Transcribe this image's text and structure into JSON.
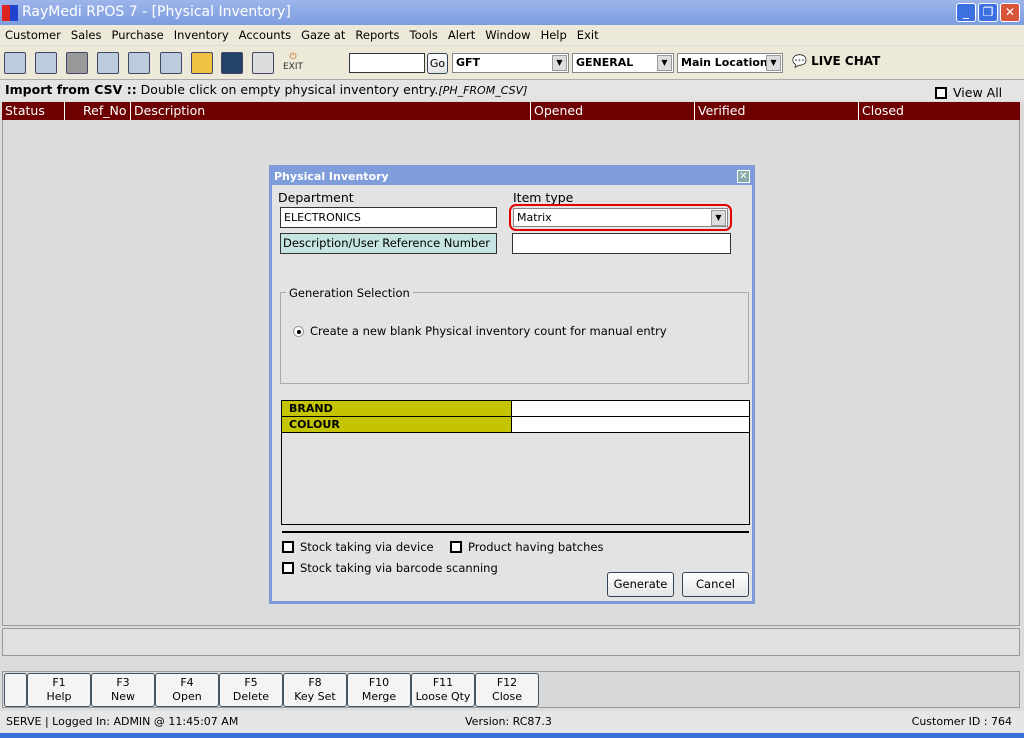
{
  "window": {
    "title": "RayMedi RPOS 7 - [Physical Inventory]"
  },
  "menu": [
    "Customer",
    "Sales",
    "Purchase",
    "Inventory",
    "Accounts",
    "Gaze at",
    "Reports",
    "Tools",
    "Alert",
    "Window",
    "Help",
    "Exit"
  ],
  "toolbar": {
    "exit_label": "EXIT",
    "search_value": "",
    "go_label": "Go",
    "combo1": "GFT",
    "combo2": "GENERAL",
    "combo3": "Main Location",
    "live_chat": "LIVE CHAT"
  },
  "info": {
    "bold": "Import from CSV ::",
    "text": " Double click on empty physical inventory entry.",
    "code": "[PH_FROM_CSV]",
    "view_all": "View All"
  },
  "grid": {
    "columns": [
      "Status",
      "Ref_No",
      "Description",
      "Opened",
      "Verified",
      "Closed"
    ]
  },
  "dialog": {
    "title": "Physical Inventory",
    "department_label": "Department",
    "department_value": "ELECTRONICS",
    "item_type_label": "Item type",
    "item_type_value": "Matrix",
    "desc_label": "Description/User Reference Number",
    "desc_value": "",
    "generation_label": "Generation Selection",
    "radio_label": "Create a new blank Physical inventory count for manual entry",
    "attributes": [
      {
        "name": "BRAND",
        "value": ""
      },
      {
        "name": "COLOUR",
        "value": ""
      }
    ],
    "cb_device": "Stock taking via device",
    "cb_batches": "Product having batches",
    "cb_barcode": "Stock taking via barcode scanning",
    "generate": "Generate",
    "cancel": "Cancel",
    "attr_color": "#c4c400",
    "highlight_color": "#e00000"
  },
  "fkeys": [
    {
      "k": "F1",
      "l": "Help"
    },
    {
      "k": "F3",
      "l": "New"
    },
    {
      "k": "F4",
      "l": "Open"
    },
    {
      "k": "F5",
      "l": "Delete"
    },
    {
      "k": "F8",
      "l": "Key Set"
    },
    {
      "k": "F10",
      "l": "Merge"
    },
    {
      "k": "F11",
      "l": "Loose Qty"
    },
    {
      "k": "F12",
      "l": "Close"
    }
  ],
  "status": {
    "left": "SERVE |  Logged In: ADMIN  @ 11:45:07 AM",
    "version": "Version: RC87.3",
    "customer": "Customer ID : 764"
  }
}
